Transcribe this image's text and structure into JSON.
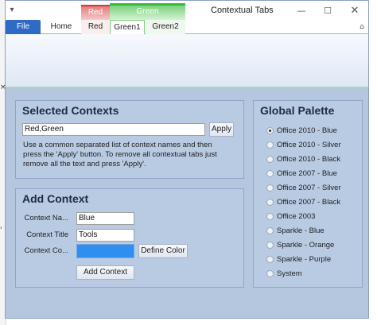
{
  "window": {
    "title": "Contextual Tabs"
  },
  "contexts": {
    "red": "Red",
    "green": "Green"
  },
  "tabs": [
    {
      "label": "File"
    },
    {
      "label": "Home"
    },
    {
      "label": "Red"
    },
    {
      "label": "Green1"
    },
    {
      "label": "Green2"
    }
  ],
  "selected_contexts": {
    "title": "Selected Contexts",
    "value": "Red,Green",
    "apply_label": "Apply",
    "description": "Use a common separated list of context names and then press the 'Apply' button. To remove all contextual tabs just remove all the text and press 'Apply'."
  },
  "add_context": {
    "title": "Add Context",
    "name_label": "Context Na...",
    "name_value": "Blue",
    "title_label": "Context Title",
    "title_value": "Tools",
    "color_label": "Context Co...",
    "color_value": "#2e8ff0",
    "define_color_label": "Define Color",
    "add_button_label": "Add Context"
  },
  "palette": {
    "title": "Global Palette",
    "selected_index": 0,
    "options": [
      "Office 2010 - Blue",
      "Office 2010 - Silver",
      "Office 2010 - Black",
      "Office 2007 - Blue",
      "Office 2007 - Silver",
      "Office 2007 - Black",
      "Office 2003",
      "Sparkle - Blue",
      "Sparkle - Orange",
      "Sparkle - Purple",
      "System"
    ]
  }
}
